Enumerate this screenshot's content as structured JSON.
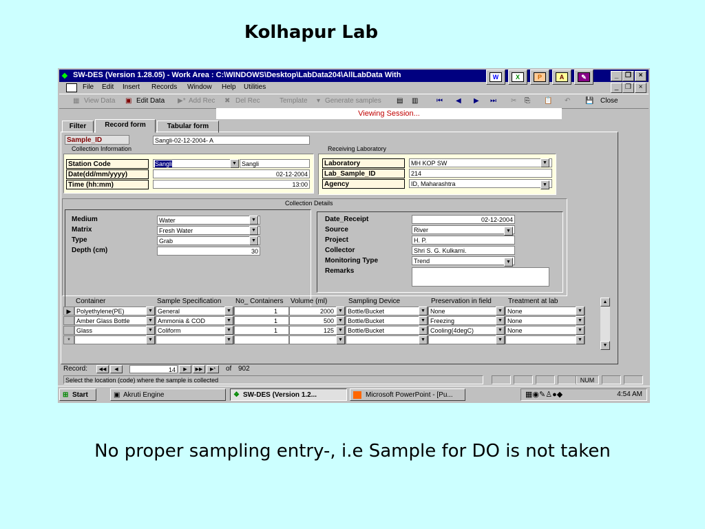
{
  "slide": {
    "title": "Kolhapur Lab",
    "caption": "No proper sampling entry-, i.e Sample for DO is not taken"
  },
  "window": {
    "title": "SW-DES (Version 1.28.05) - Work Area : C:\\WINDOWS\\Desktop\\LabData204\\AllLabData With",
    "menu": [
      "File",
      "Edit",
      "Insert",
      "Records",
      "Window",
      "Help",
      "Utilities"
    ],
    "toolbar": {
      "view_data": "View Data",
      "edit_data": "Edit Data",
      "add_rec": "Add Rec",
      "del_rec": "Del Rec",
      "template": "Template",
      "generate": "Generate samples",
      "close": "Close"
    }
  },
  "viewing_banner": "Viewing Session...",
  "tabs": [
    "Filter",
    "Record form",
    "Tabular form"
  ],
  "sample": {
    "label": "Sample_ID",
    "value": "Sangli-02-12-2004- A"
  },
  "collection_info": {
    "heading": "Collection Information",
    "station_code_label": "Station Code",
    "station_code": "Sangli",
    "station_name": "Sangli",
    "date_label": "Date(dd/mm/yyyy)",
    "date": "02-12-2004",
    "time_label": "Time (hh:mm)",
    "time": "13:00"
  },
  "receiving_lab": {
    "heading": "Receiving Laboratory",
    "laboratory_label": "Laboratory",
    "laboratory": "MH KOP SW",
    "lab_sample_label": "Lab_Sample_ID",
    "lab_sample": "214",
    "agency_label": "Agency",
    "agency": "ID, Maharashtra"
  },
  "collection_details": {
    "heading": "Collection Details",
    "medium_label": "Medium",
    "medium": "Water",
    "matrix_label": "Matrix",
    "matrix": "Fresh Water",
    "type_label": "Type",
    "type": "Grab",
    "depth_label": "Depth (cm)",
    "depth": "30",
    "date_receipt_label": "Date_Receipt",
    "date_receipt": "02-12-2004",
    "source_label": "Source",
    "source": "River",
    "project_label": "Project",
    "project": "H. P.",
    "collector_label": "Collector",
    "collector": "Shri S. G. Kulkarni.",
    "monitoring_label": "Monitoring Type",
    "monitoring": "Trend",
    "remarks_label": "Remarks",
    "remarks": ""
  },
  "grid": {
    "headers": [
      "Container",
      "Sample Specification",
      "No_ Containers",
      "Volume (ml)",
      "Sampling Device",
      "Preservation in field",
      "Treatment at lab"
    ],
    "rows": [
      [
        "Polyethylene(PE)",
        "General",
        "1",
        "2000",
        "Bottle/Bucket",
        "None",
        "None"
      ],
      [
        "Amber Glass Bottle",
        "Ammonia & COD",
        "1",
        "500",
        "Bottle/Bucket",
        "Freezing",
        "None"
      ],
      [
        "Glass",
        "Coliform",
        "1",
        "125",
        "Bottle/Bucket",
        "Cooling(4degC)",
        "None"
      ]
    ],
    "new_row_marker": "*",
    "current_row_marker": "▶"
  },
  "record_nav": {
    "label": "Record:",
    "current": "14",
    "of_label": "of",
    "total": "902"
  },
  "status": {
    "text": "Select the location (code) where the sample is collected",
    "num": "NUM"
  },
  "taskbar": {
    "start": "Start",
    "tasks": [
      "Akruti Engine",
      "SW-DES (Version 1.2...",
      "Microsoft PowerPoint - [Pu..."
    ],
    "clock": "4:54 AM"
  }
}
